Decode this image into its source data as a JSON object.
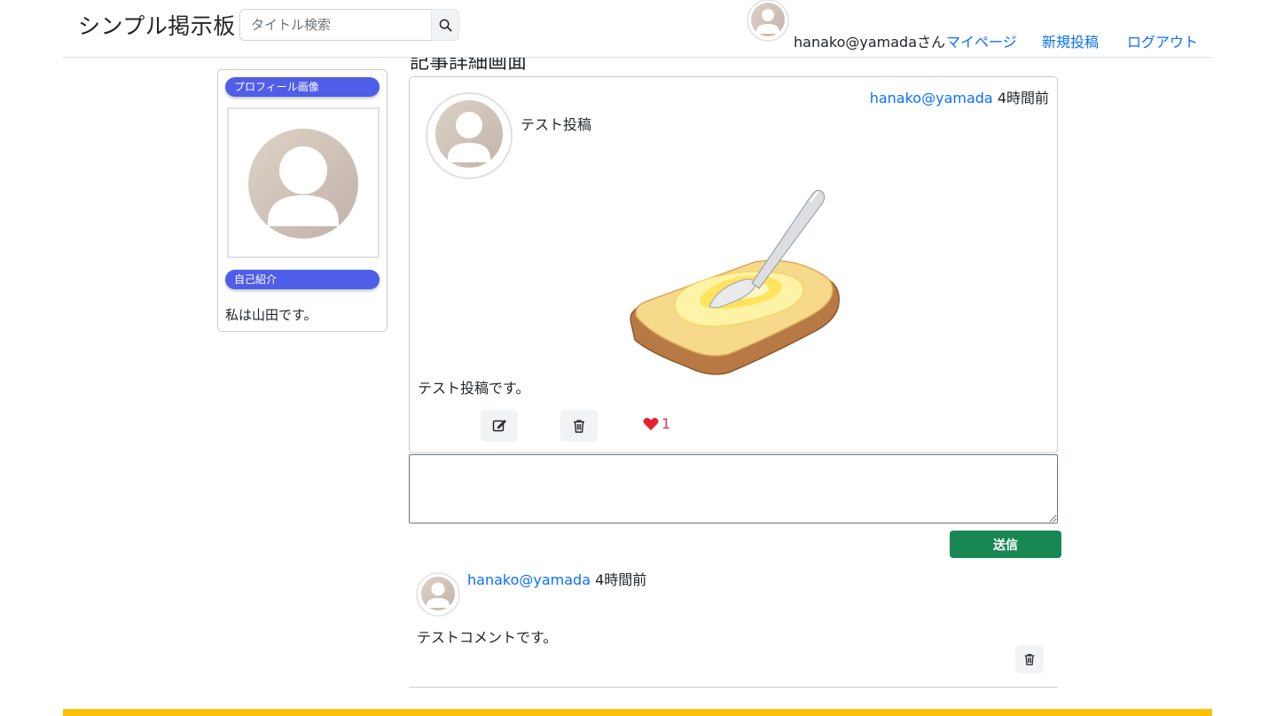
{
  "header": {
    "brand": "シンプル掲示板",
    "search_placeholder": "タイトル検索",
    "search_icon": "search-icon",
    "user_label": "hanako@yamadaさん",
    "nav_mypage": "マイページ",
    "nav_new_post": "新規投稿",
    "nav_logout": "ログアウト"
  },
  "page": {
    "title": "記事詳細画面"
  },
  "sidebar": {
    "profile_label": "プロフィール画像",
    "bio_label": "自己紹介",
    "bio_text": "私は山田です。"
  },
  "post": {
    "author": "hanako@yamada",
    "time": "4時間前",
    "title": "テスト投稿",
    "body": "テスト投稿です。",
    "like_count": "1",
    "image": "buttered-toast-illustration"
  },
  "comment_form": {
    "value": "",
    "submit_label": "送信"
  },
  "comments": [
    {
      "author": "hanako@yamada",
      "time": "4時間前",
      "body": "テストコメントです。"
    }
  ],
  "colors": {
    "accent": "#0d6efd",
    "pill": "#4f5ee8",
    "submit": "#198754",
    "footer": "#ffc107",
    "like": "#dc3545"
  }
}
